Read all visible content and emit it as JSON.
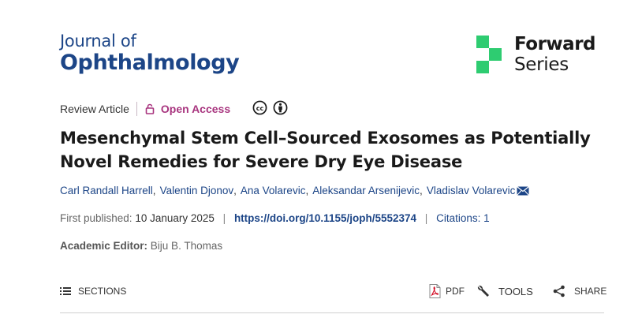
{
  "journal": {
    "line1": "Journal of",
    "line2": "Ophthalmology"
  },
  "brand": {
    "word1": "Forward",
    "word2": "Series",
    "logo_color": "#2ecc71"
  },
  "article": {
    "type": "Review Article",
    "access": "Open Access",
    "title": "Mesenchymal Stem Cell–Sourced Exosomes as Potentially Novel Remedies for Severe Dry Eye Disease",
    "authors": [
      "Carl Randall Harrell",
      "Valentin Djonov",
      "Ana Volarevic",
      "Aleksandar Arsenijevic",
      "Vladislav Volarevic"
    ],
    "first_published_label": "First published:",
    "first_published_date": "10 January 2025",
    "doi": "https://doi.org/10.1155/joph/5552374",
    "citations": "Citations: 1",
    "editor_label": "Academic Editor:",
    "editor_name": "Biju B. Thomas"
  },
  "toolbar": {
    "sections": "SECTIONS",
    "pdf": "PDF",
    "tools": "TOOLS",
    "share": "SHARE"
  },
  "colors": {
    "navy": "#1c4587",
    "access": "#a8357f",
    "green": "#2ecc71"
  },
  "icons": [
    "lock-icon",
    "cc-icon",
    "by-icon",
    "mail-icon",
    "list-icon",
    "pdf-icon",
    "wrench-icon",
    "share-icon"
  ]
}
